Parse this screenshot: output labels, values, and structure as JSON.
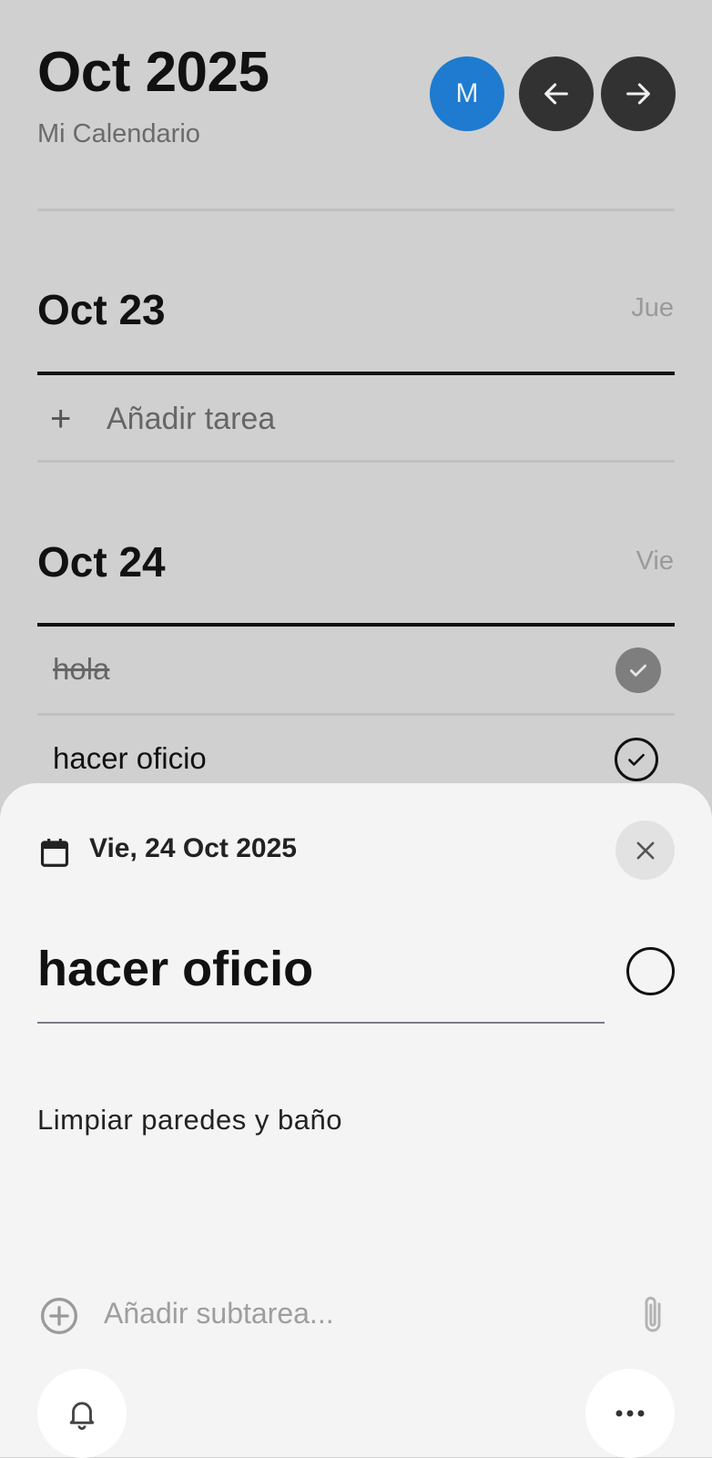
{
  "header": {
    "month_title": "Oct 2025",
    "calendar_name": "Mi Calendario",
    "avatar_initial": "M",
    "prev_icon": "arrow-left-icon",
    "next_icon": "arrow-right-icon"
  },
  "days": [
    {
      "date": "Oct 23",
      "weekday": "Jue",
      "add_task_label": "Añadir tarea",
      "tasks": []
    },
    {
      "date": "Oct 24",
      "weekday": "Vie",
      "tasks": [
        {
          "title": "hola",
          "completed": true
        },
        {
          "title": "hacer oficio",
          "completed": false
        }
      ]
    }
  ],
  "sheet": {
    "date_label": "Vie, 24 Oct 2025",
    "task_title": "hacer oficio",
    "description": "Limpiar paredes y baño",
    "subtask_placeholder": "Añadir subtarea...",
    "icons": {
      "calendar": "calendar-icon",
      "close": "close-icon",
      "add_subtask": "plus-circle-icon",
      "attach": "paperclip-icon",
      "reminder": "bell-icon",
      "more": "more-horizontal-icon"
    }
  },
  "colors": {
    "accent": "#1e7bcf",
    "nav_button": "#323232",
    "background": "#d0d0d0",
    "sheet": "#f4f4f4"
  }
}
